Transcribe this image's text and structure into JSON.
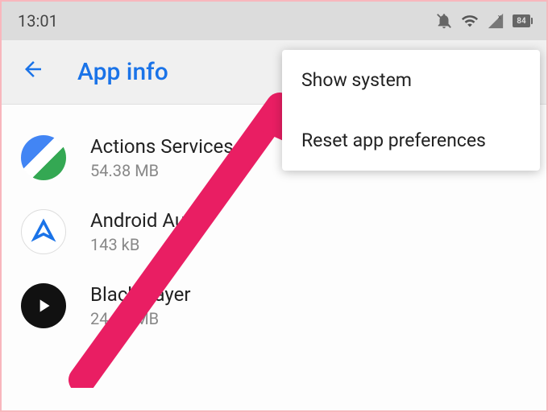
{
  "status_bar": {
    "time": "13:01",
    "battery": "84"
  },
  "app_bar": {
    "title": "App info"
  },
  "menu": {
    "show_system": "Show system",
    "reset_prefs": "Reset app preferences"
  },
  "apps": [
    {
      "name": "Actions Services",
      "size": "54.38 MB"
    },
    {
      "name": "Android Auto",
      "size": "143 kB"
    },
    {
      "name": "BlackPlayer",
      "size": "24.93 MB"
    }
  ]
}
